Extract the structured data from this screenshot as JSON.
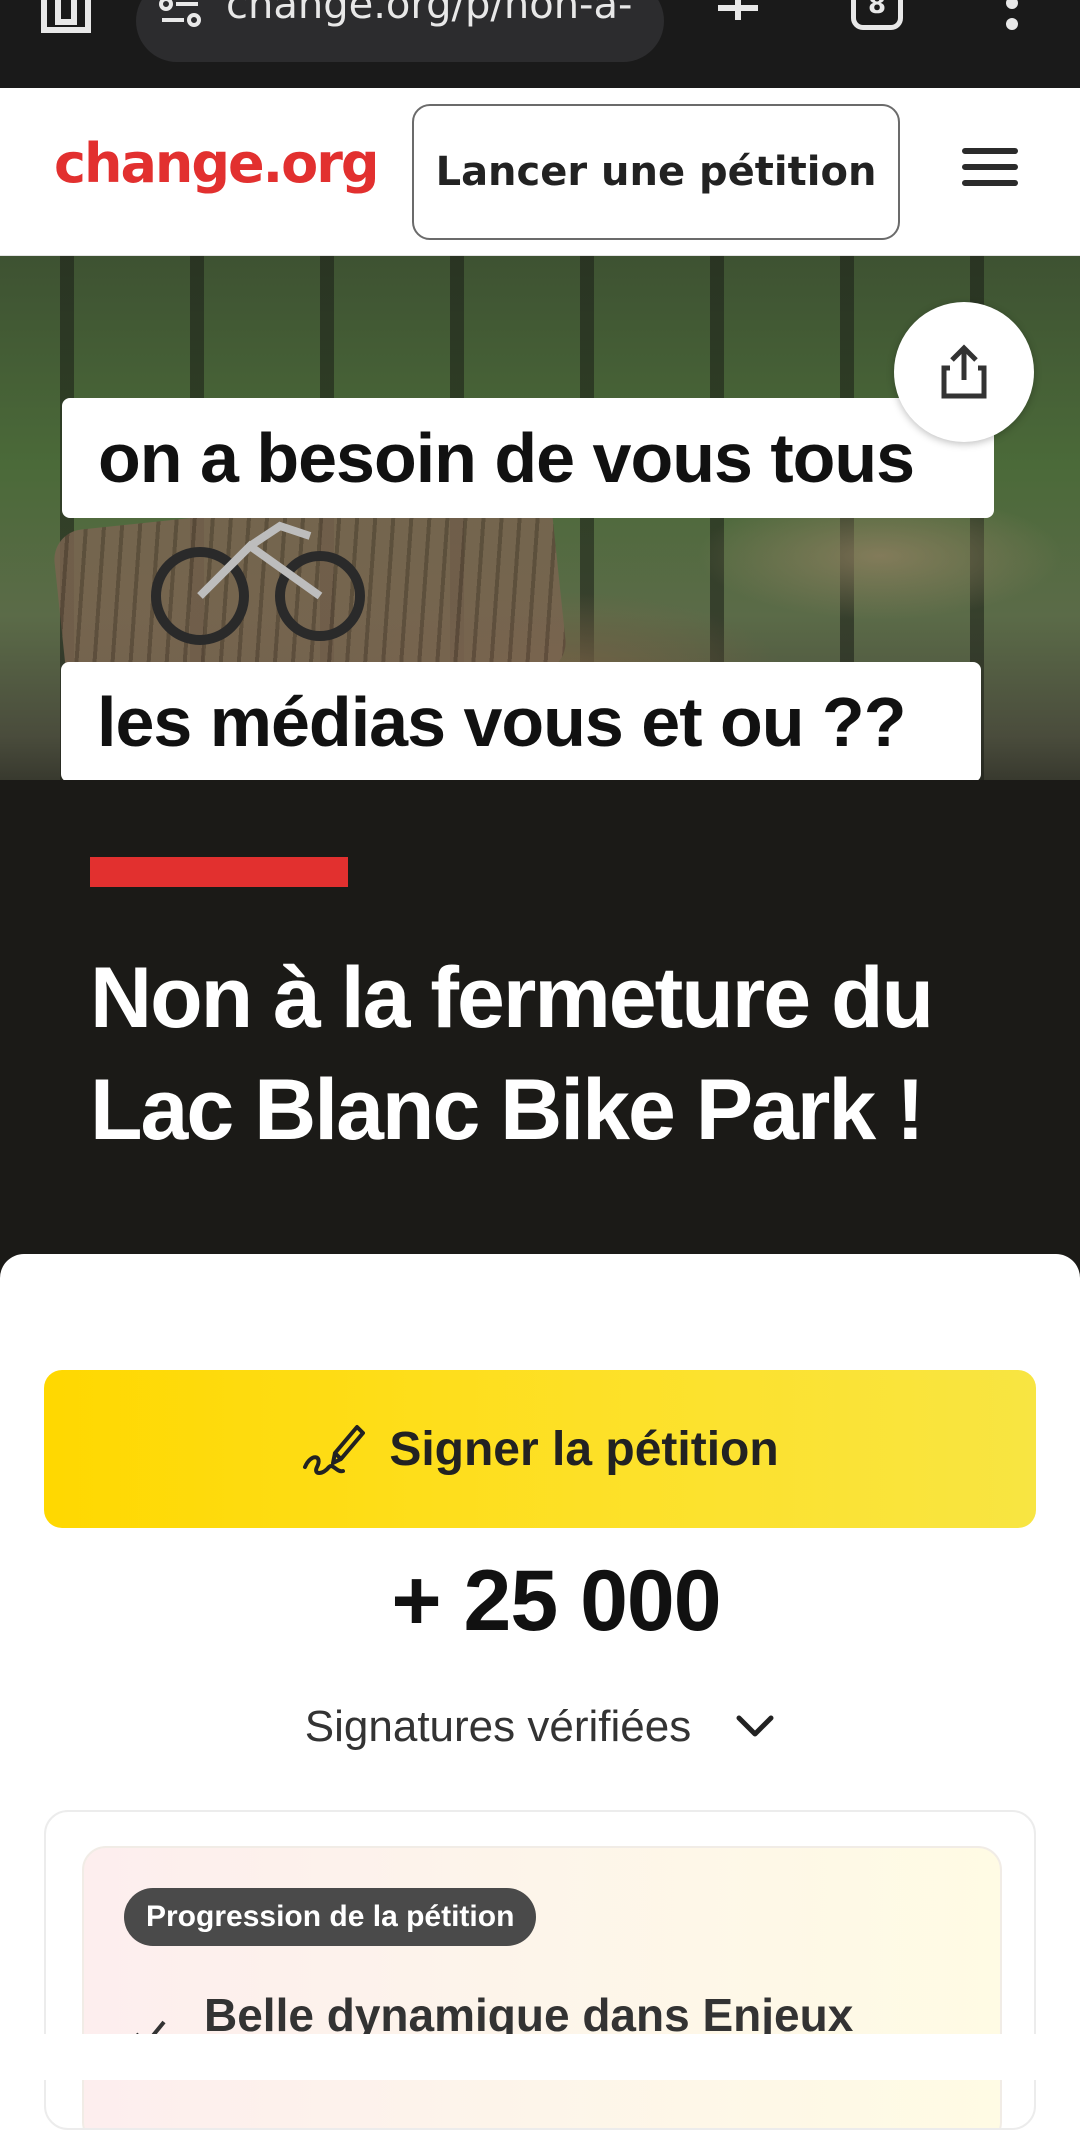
{
  "browser": {
    "url": "change.org/p/non-a-",
    "tab_count": "8"
  },
  "header": {
    "logo": "change.org",
    "start_button": "Lancer une pétition"
  },
  "hero": {
    "overlay_line_1": "on a besoin de vous tous",
    "overlay_line_2": "les médias vous et ou ??"
  },
  "petition": {
    "title": "Non à la fermeture du Lac Blanc Bike Park !",
    "sign_button": "Signer la pétition",
    "signature_count": "+ 25 000",
    "verified_label": "Signatures vérifiées",
    "progress_badge": "Progression de la pétition",
    "momentum_text": "Belle dynamique dans Enjeux"
  },
  "colors": {
    "brand_red": "#e2302f",
    "sign_yellow": "#ffd800",
    "dark_bg": "#1b1a17"
  }
}
